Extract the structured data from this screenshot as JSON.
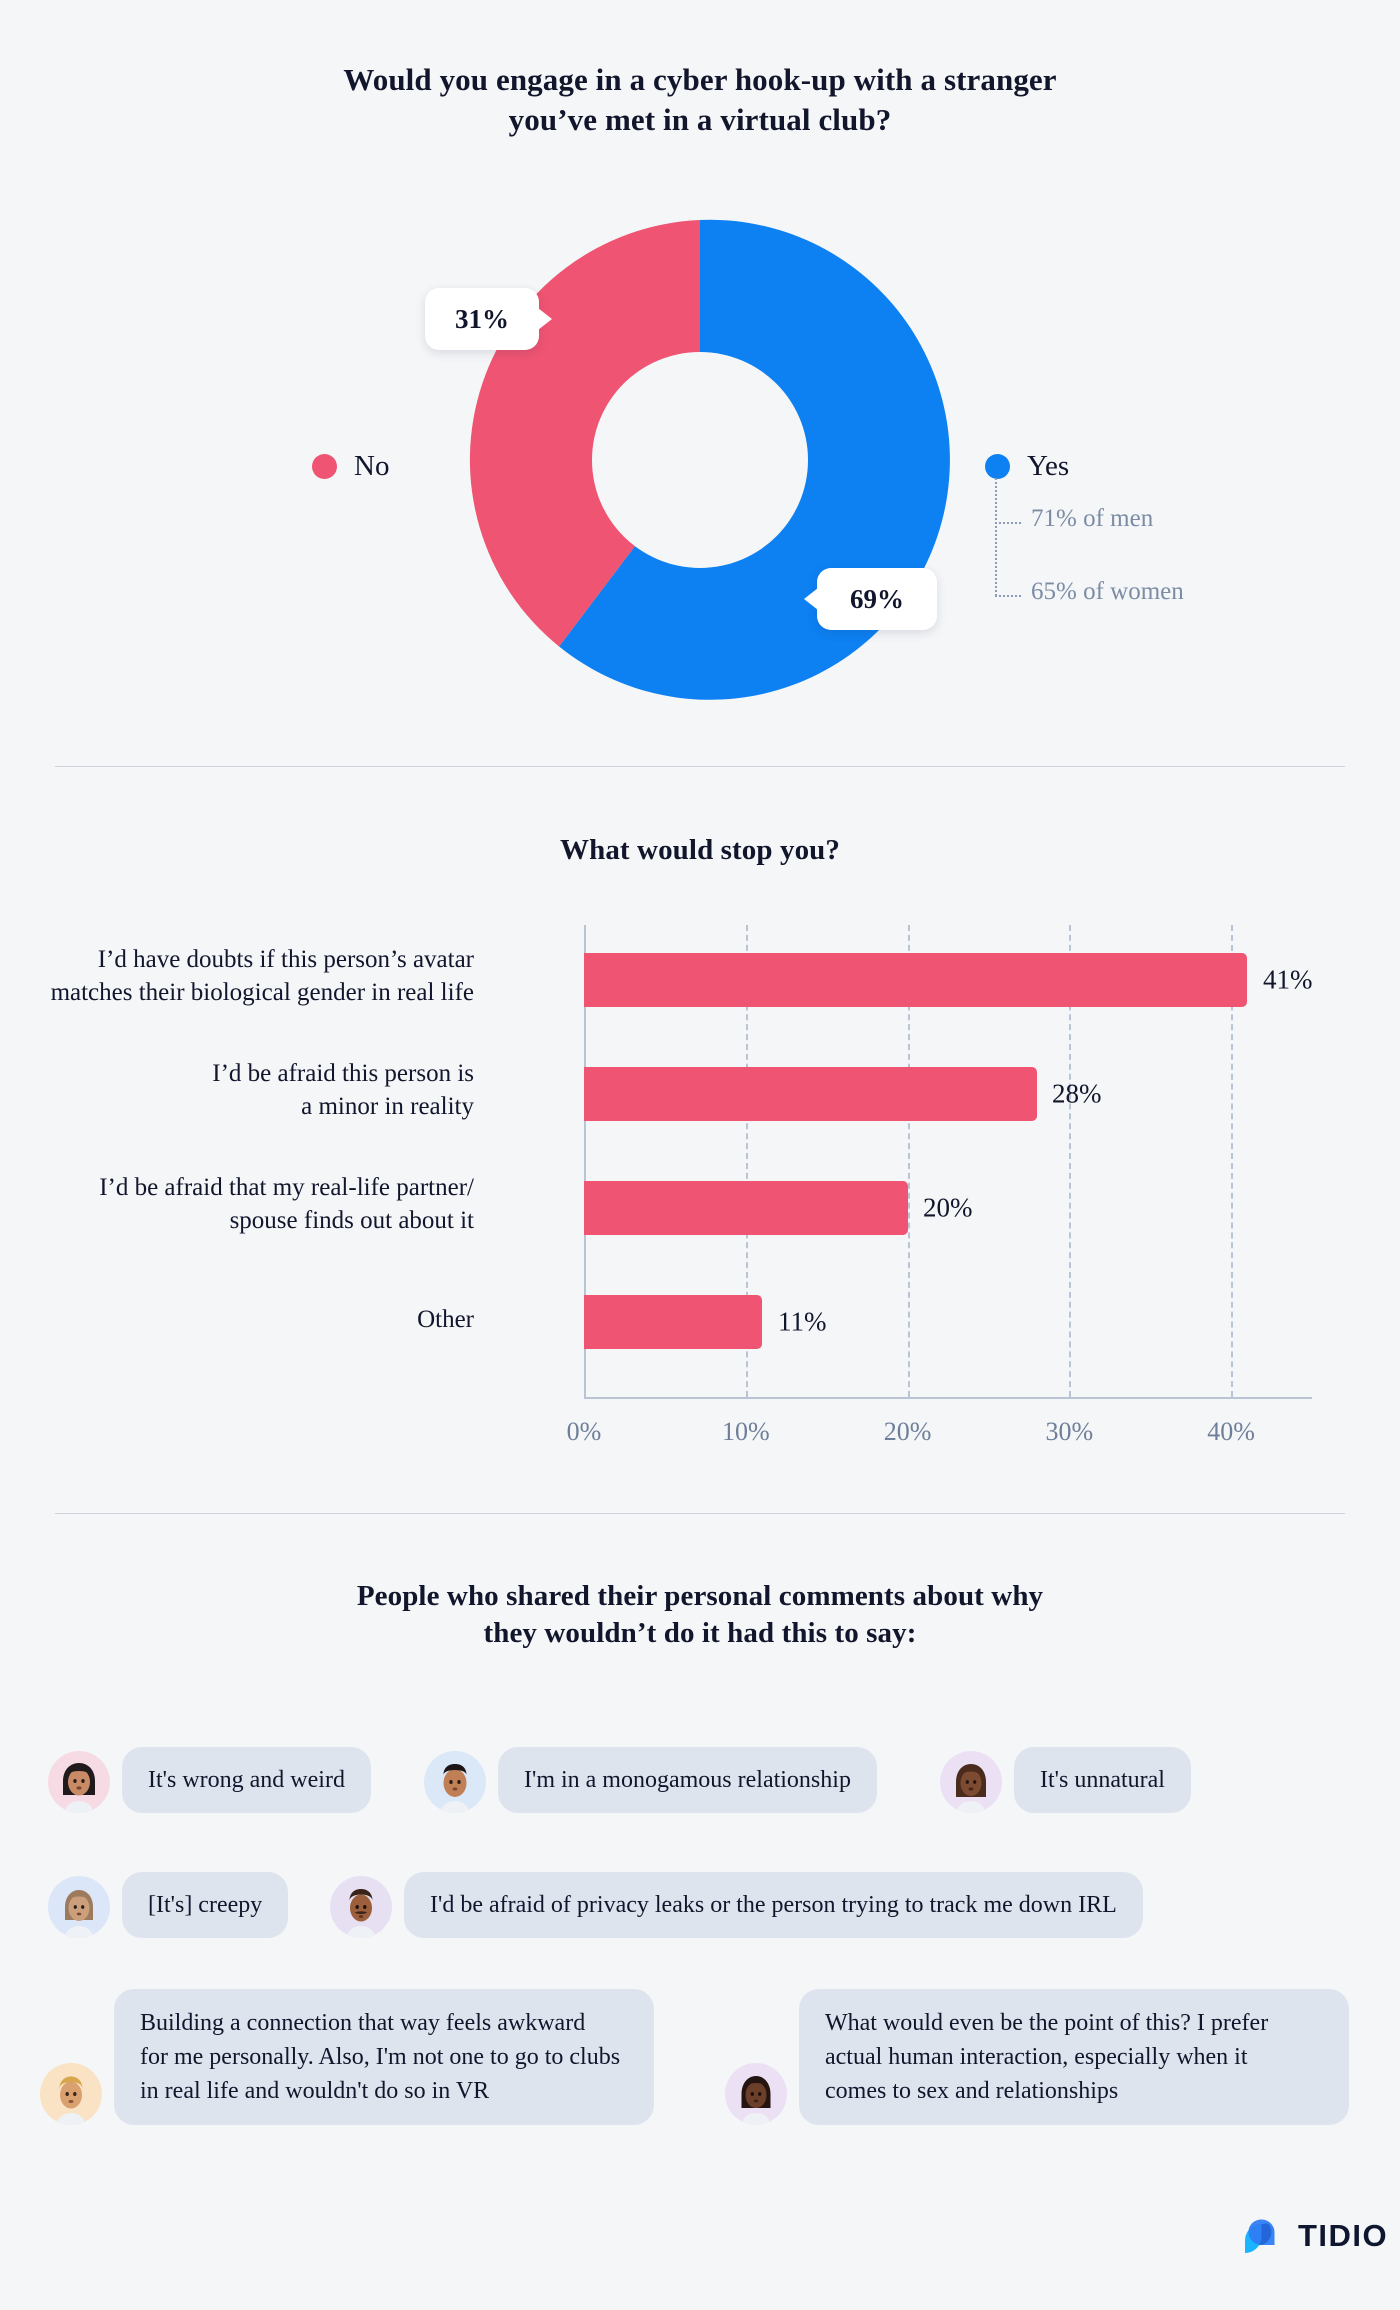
{
  "colors": {
    "background": "#f4f6f8",
    "yes_blue": "#0d80f2",
    "no_pink": "#ef5472",
    "bar_pink": "#ef5472",
    "muted_text": "#7c8ca5",
    "bubble_bg": "#dde4ee",
    "divider": "#ccd3dd"
  },
  "section1": {
    "title_line1": "Would you engage in a cyber hook-up with a stranger",
    "title_line2": "you’ve met in a virtual club?",
    "callouts": {
      "no": "31%",
      "yes": "69%"
    },
    "legend": [
      {
        "label": "No",
        "color": "#ef5472"
      },
      {
        "label": "Yes",
        "color": "#0d80f2"
      }
    ],
    "yes_breakdown": [
      "71% of men",
      "65% of women"
    ],
    "chart_data": {
      "type": "pie",
      "title": "Would you engage in a cyber hook-up with a stranger you’ve met in a virtual club?",
      "labels": [
        "Yes",
        "No"
      ],
      "values": [
        69,
        31
      ],
      "colors": [
        "#0d80f2",
        "#ef5472"
      ],
      "donut": true,
      "hole_ratio": 0.55,
      "annotations": [
        "71% of men",
        "65% of women"
      ],
      "legend_position": "sides"
    }
  },
  "section2": {
    "title": "What would stop you?",
    "chart_data": {
      "type": "bar",
      "orientation": "horizontal",
      "title": "What would stop you?",
      "categories": [
        "I’d have doubts if this person’s avatar\nmatches their biological gender in real life",
        "I’d be afraid this person is\na minor in reality",
        "I’d be afraid that my real-life partner/\nspouse finds out about it",
        "Other"
      ],
      "values": [
        41,
        28,
        20,
        11
      ],
      "value_labels": [
        "41%",
        "28%",
        "20%",
        "11%"
      ],
      "tick_labels": [
        "0%",
        "10%",
        "20%",
        "30%",
        "40%"
      ],
      "tick_values": [
        0,
        10,
        20,
        30,
        40
      ],
      "xlim": [
        0,
        45
      ],
      "xlabel": "",
      "ylabel": "",
      "grid": true,
      "color": "#ef5472"
    }
  },
  "section3": {
    "title_line1": "People who shared their personal comments about why",
    "title_line2": "they wouldn’t do it had this to say:",
    "comments": [
      {
        "text": "It's wrong and weird",
        "avatar": "avatar-woman-black-hair",
        "ring": "#f7dbe4",
        "skin": "#c98a66",
        "hair": "#211a1c"
      },
      {
        "text": "I'm in a monogamous relationship",
        "avatar": "avatar-man-flattop",
        "ring": "#dbe8f8",
        "skin": "#c07f54",
        "hair": "#1b1517"
      },
      {
        "text": "It's unnatural",
        "avatar": "avatar-woman-brown-hair",
        "ring": "#ece0f5",
        "skin": "#7d4a32",
        "hair": "#4a2b1c"
      },
      {
        "text": "[It's] creepy",
        "avatar": "avatar-person-bob-hair",
        "ring": "#dbe6f8",
        "skin": "#cb9e7c",
        "hair": "#9c7a5c"
      },
      {
        "text": "I'd be afraid of privacy leaks or the person trying to track me down IRL",
        "avatar": "avatar-man-moustache",
        "ring": "#e6e0f2",
        "skin": "#9b5f3c",
        "hair": "#3a2318"
      },
      {
        "text": "Building a connection that way feels awkward\nfor me personally. Also, I'm not one to go to clubs\nin real life and wouldn't do so in VR",
        "avatar": "avatar-man-blond",
        "ring": "#fae3c4",
        "skin": "#d9a070",
        "hair": "#d8a64b"
      },
      {
        "text": "What would even be the point of this? I prefer\nactual human interaction, especially when it\ncomes to sex and relationships",
        "avatar": "avatar-woman-dark-skin",
        "ring": "#ece0f5",
        "skin": "#6b3f2a",
        "hair": "#241510"
      }
    ]
  },
  "footer": {
    "brand": "TIDIO"
  }
}
